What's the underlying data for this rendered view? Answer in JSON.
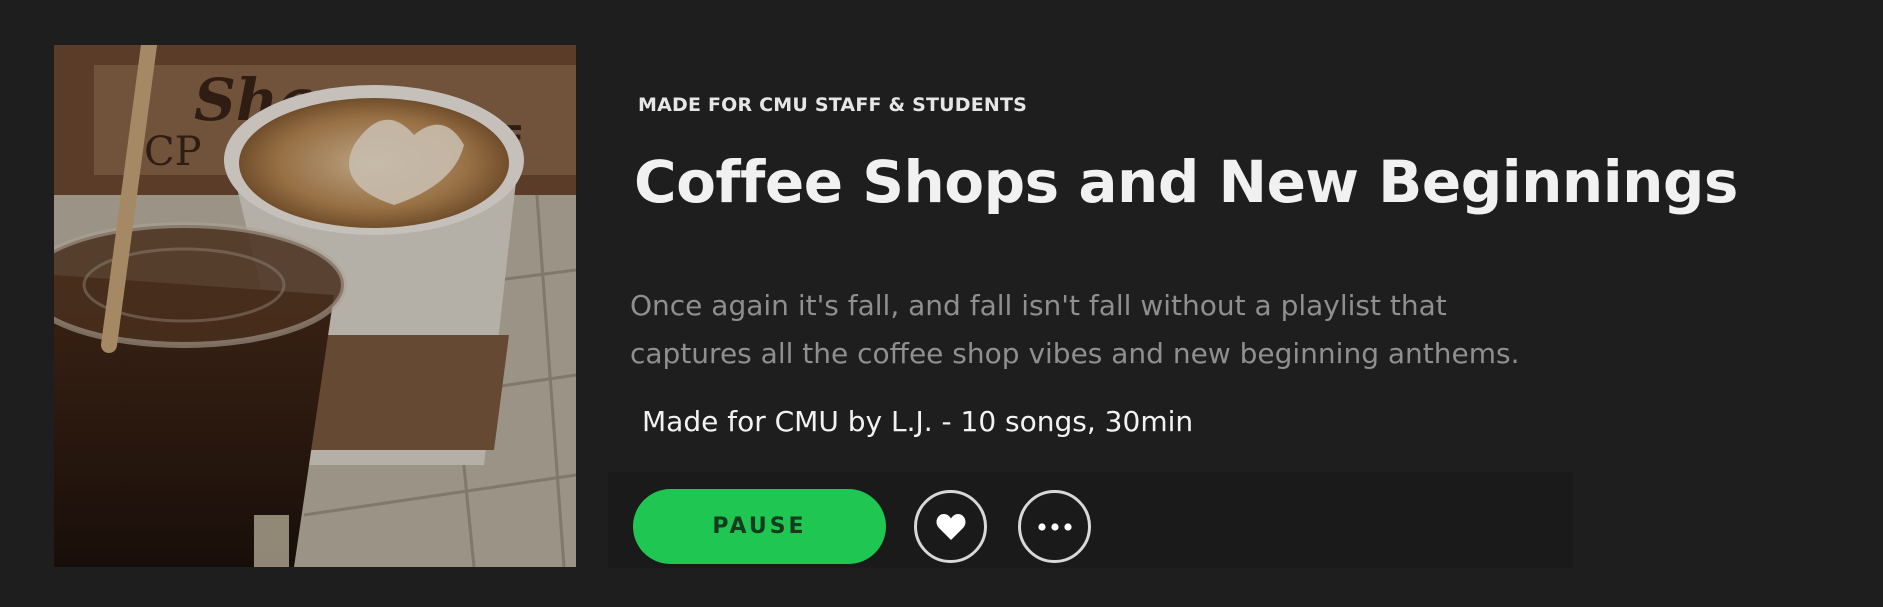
{
  "playlist": {
    "eyebrow": "MADE FOR CMU STAFF & STUDENTS",
    "title": "Coffee Shops and New Beginnings",
    "description_lines": [
      "Once again it's fall, and fall isn't fall without a playlist that",
      "captures all the coffee shop vibes and new beginning anthems."
    ],
    "meta": "Made for CMU by L.J. - 10 songs, 30min",
    "cover_icon": "coffee-cups-photo"
  },
  "controls": {
    "pause_label": "PAUSE",
    "like_icon": "heart-icon",
    "more_icon": "ellipsis-icon"
  },
  "colors": {
    "background": "#1e1e1e",
    "accent": "#1fc651",
    "title": "#f1f1f1",
    "description": "#8f8f8f"
  }
}
